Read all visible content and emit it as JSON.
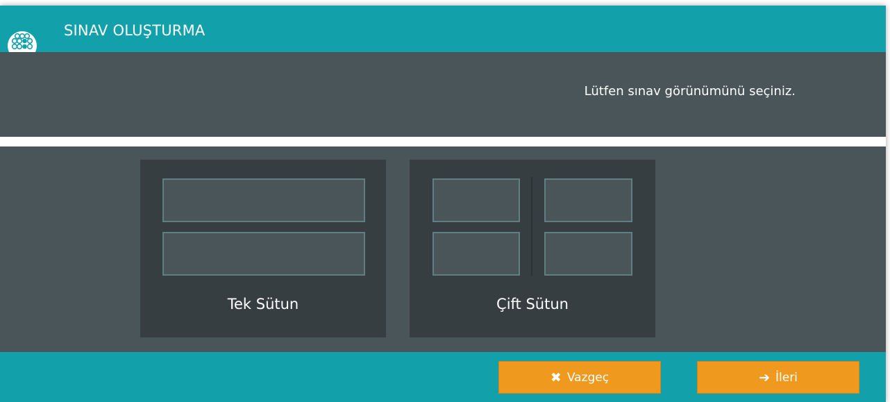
{
  "window": {
    "title": "SINAV OLUŞTURMA"
  },
  "prompt": {
    "text": "Lütfen sınav görünümünü seçiniz."
  },
  "options": [
    {
      "label": "Tek Sütun"
    },
    {
      "label": "Çift Sütun"
    }
  ],
  "footer": {
    "cancel_icon": "✖",
    "cancel_label": "Vazgeç",
    "next_icon": "➔",
    "next_label": "İleri"
  },
  "colors": {
    "accent": "#12a0aa",
    "panel": "#4a5559",
    "card": "#363e42",
    "button": "#f0991f"
  }
}
